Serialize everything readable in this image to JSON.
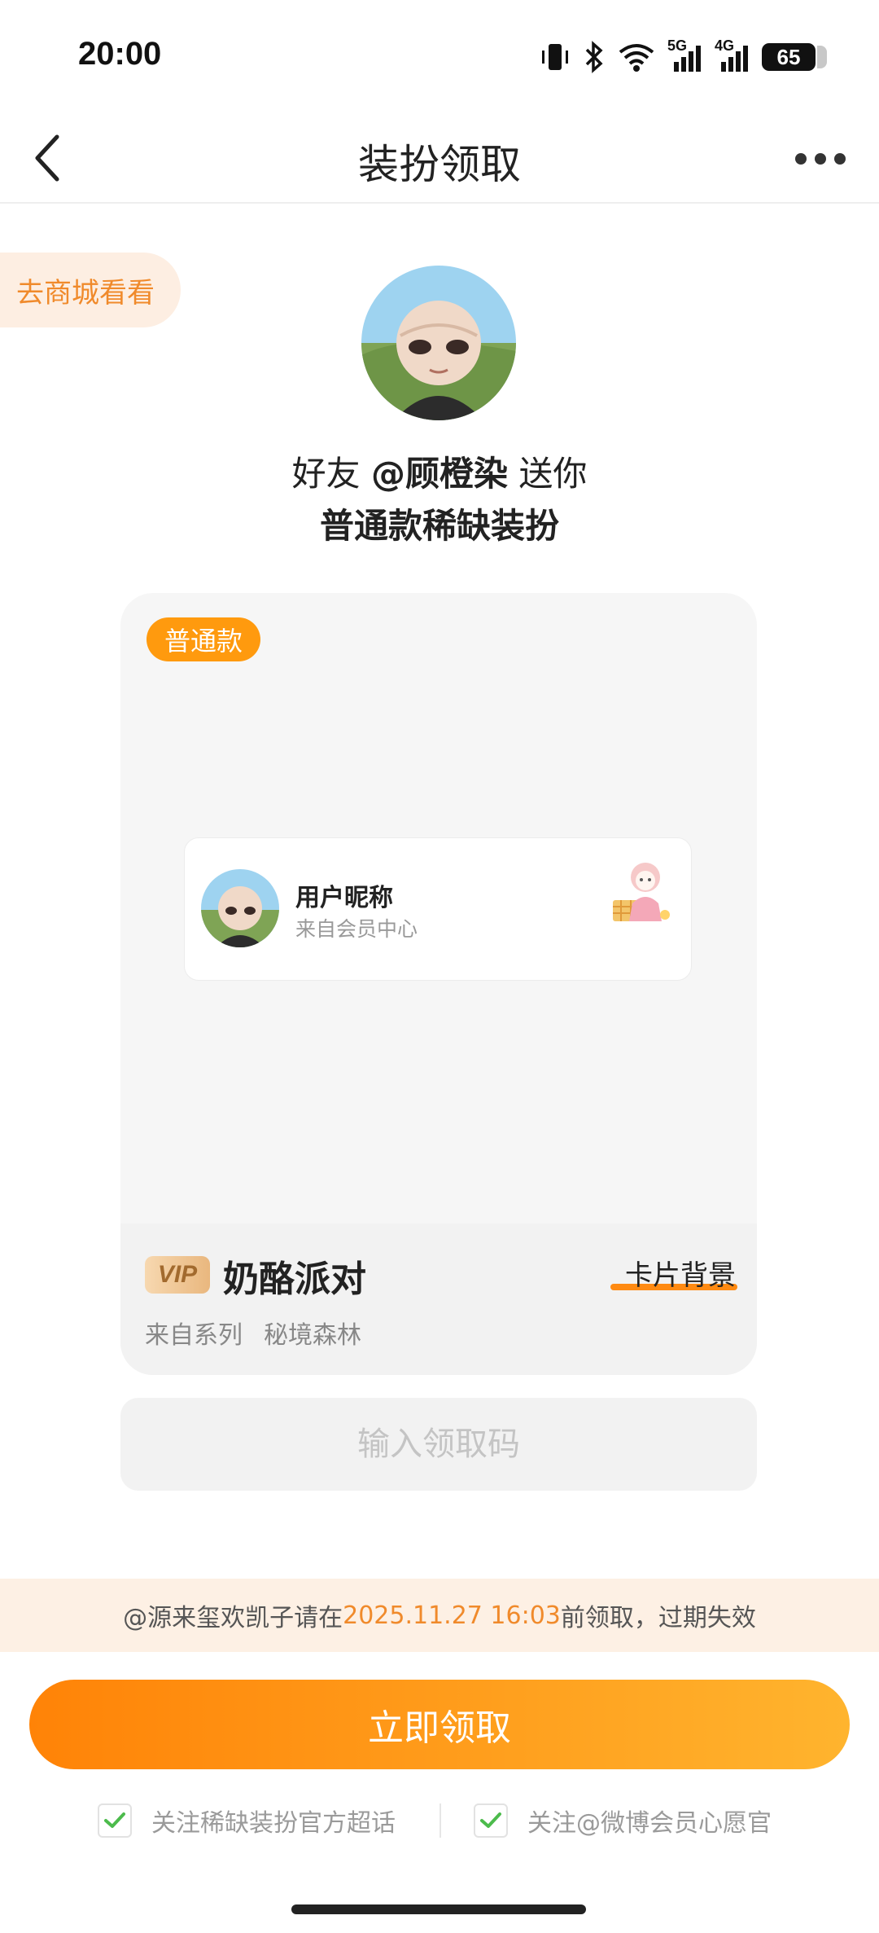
{
  "status_bar": {
    "time": "20:00",
    "network_1": "5G",
    "network_2": "4G",
    "battery": "65"
  },
  "nav": {
    "title": "装扮领取"
  },
  "shop_tag": "去商城看看",
  "gift": {
    "prefix": "好友 ",
    "friend": "@顾橙染",
    "suffix": " 送你",
    "subtitle": "普通款稀缺装扮"
  },
  "card": {
    "badge": "普通款",
    "preview": {
      "name": "用户昵称",
      "source": "来自会员中心"
    },
    "vip_label": "VIP",
    "item_name": "奶酪派对",
    "item_type": "卡片背景",
    "series_label": "来自系列",
    "series_name": "秘境森林"
  },
  "code_input": {
    "placeholder": "输入领取码"
  },
  "deadline": {
    "prefix": "@源来玺欢凯子请在",
    "date": "2025.11.27 16:03",
    "suffix": "前领取，过期失效"
  },
  "claim_button": "立即领取",
  "follow": {
    "option_1": "关注稀缺装扮官方超话",
    "option_2": "关注@微博会员心愿官"
  },
  "colors": {
    "accent": "#ff8a12",
    "badge": "#ff9a0e",
    "tag_text": "#f08a2b",
    "check": "#4cbb4c"
  }
}
